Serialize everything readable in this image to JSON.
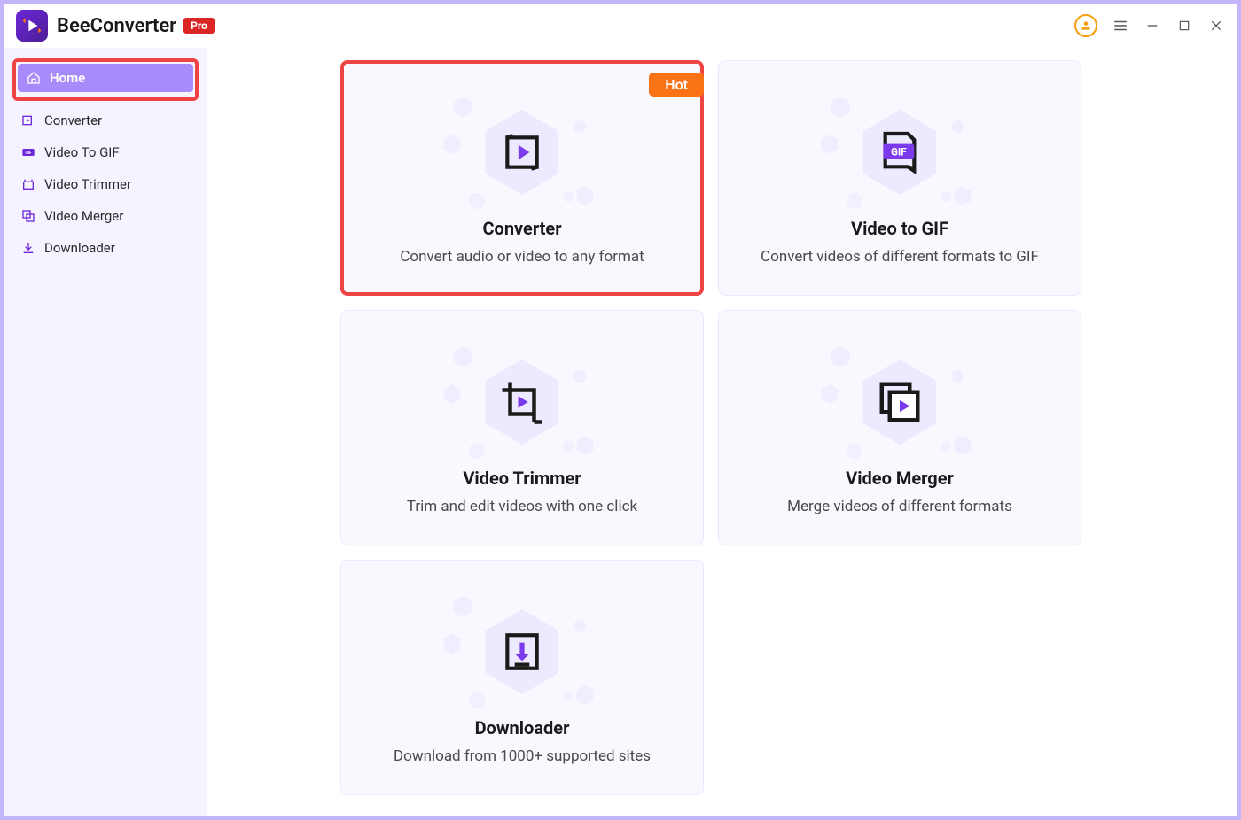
{
  "app": {
    "title": "BeeConverter",
    "badge": "Pro"
  },
  "sidebar": {
    "items": [
      {
        "label": "Home",
        "active": true
      },
      {
        "label": "Converter"
      },
      {
        "label": "Video To GIF"
      },
      {
        "label": "Video Trimmer"
      },
      {
        "label": "Video Merger"
      },
      {
        "label": "Downloader"
      }
    ]
  },
  "cards": {
    "converter": {
      "title": "Converter",
      "desc": "Convert audio or video to any format",
      "badge": "Hot",
      "highlight": true
    },
    "gif": {
      "title": "Video to GIF",
      "desc": "Convert videos of different formats to GIF"
    },
    "trimmer": {
      "title": "Video Trimmer",
      "desc": "Trim and edit videos with one click"
    },
    "merger": {
      "title": "Video Merger",
      "desc": "Merge videos of different formats"
    },
    "downloader": {
      "title": "Downloader",
      "desc": "Download from 1000+ supported sites"
    }
  },
  "colors": {
    "accent": "#7c3aed",
    "highlight": "#ef4444",
    "hot": "#f97316"
  }
}
